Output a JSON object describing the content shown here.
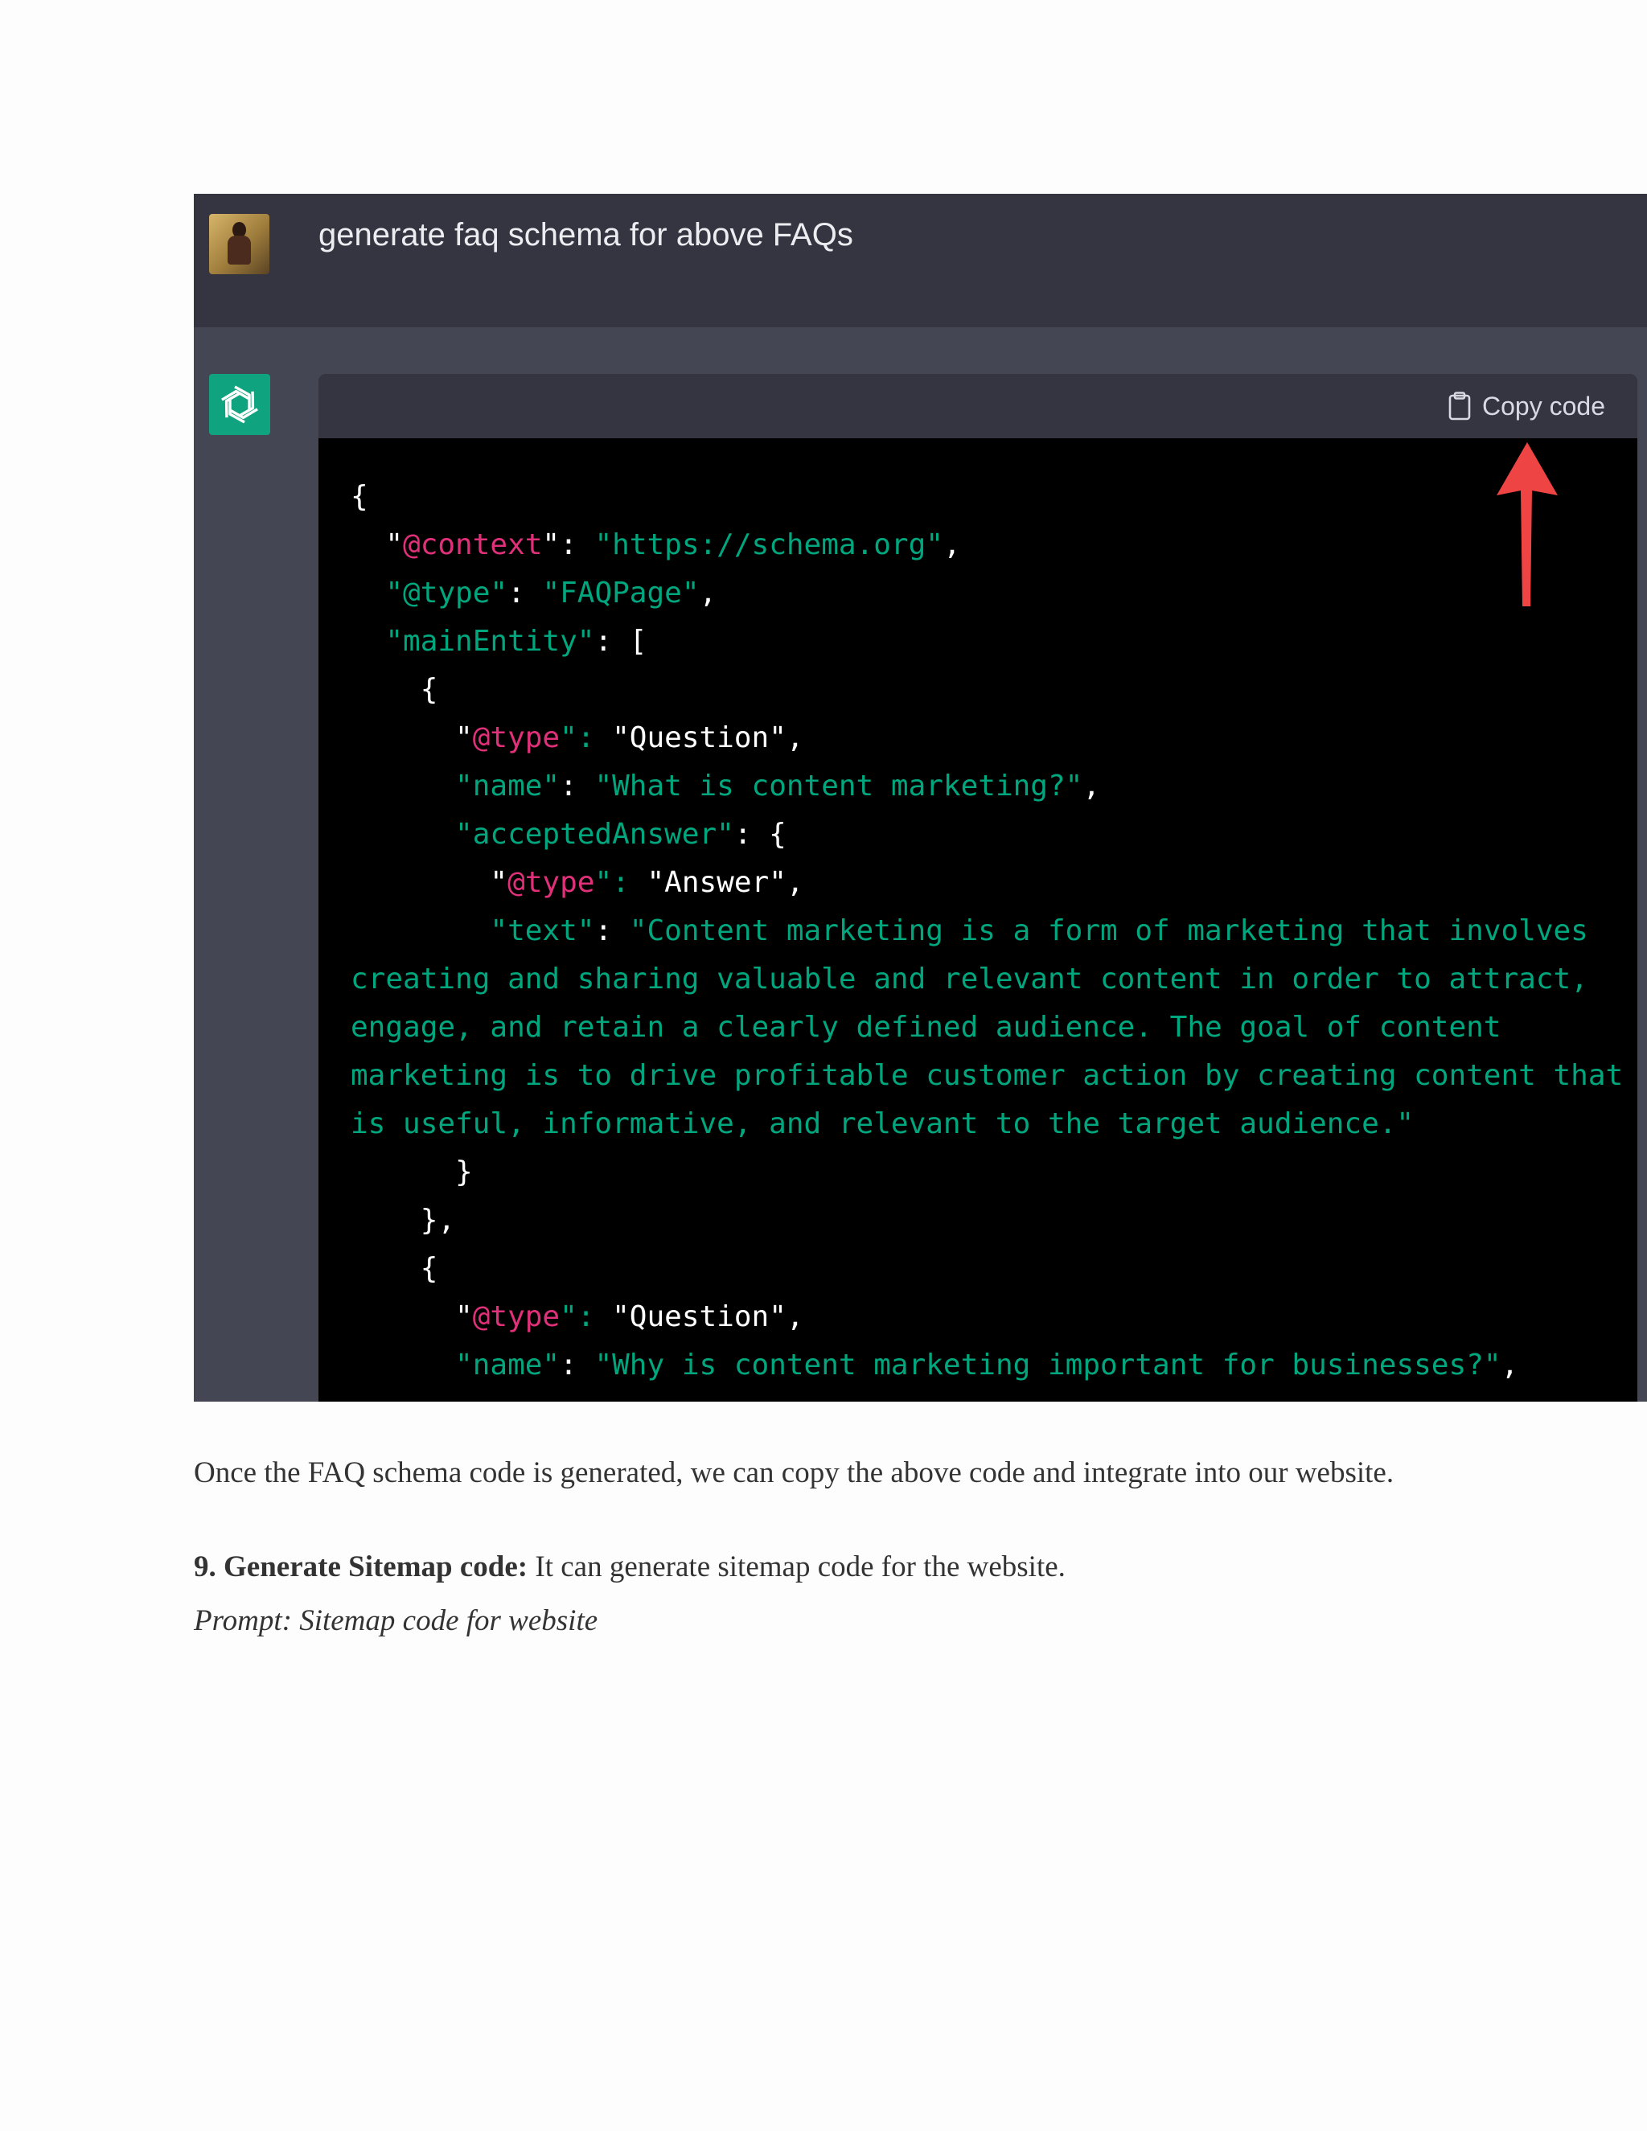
{
  "chat": {
    "user_prompt": "generate faq schema for above FAQs",
    "copy_label": "Copy code",
    "code_lines": [
      [
        {
          "t": "{",
          "c": "p"
        }
      ],
      [
        {
          "t": "  \"",
          "c": "p"
        },
        {
          "t": "@context",
          "c": "k"
        },
        {
          "t": "\": ",
          "c": "p"
        },
        {
          "t": "\"https://schema.org\"",
          "c": "s"
        },
        {
          "t": ",",
          "c": "p"
        }
      ],
      [
        {
          "t": "  \"@type\"",
          "c": "s"
        },
        {
          "t": ": ",
          "c": "p"
        },
        {
          "t": "\"FAQPage\"",
          "c": "s"
        },
        {
          "t": ",",
          "c": "p"
        }
      ],
      [
        {
          "t": "  \"mainEntity\"",
          "c": "s"
        },
        {
          "t": ": [",
          "c": "p"
        }
      ],
      [
        {
          "t": "    {",
          "c": "p"
        }
      ],
      [
        {
          "t": "      \"",
          "c": "p"
        },
        {
          "t": "@type",
          "c": "k"
        },
        {
          "t": "\": ",
          "c": "s"
        },
        {
          "t": "\"Question\",",
          "c": "p"
        }
      ],
      [
        {
          "t": "      \"name\"",
          "c": "s"
        },
        {
          "t": ": ",
          "c": "p"
        },
        {
          "t": "\"What is content marketing?\"",
          "c": "s"
        },
        {
          "t": ",",
          "c": "p"
        }
      ],
      [
        {
          "t": "      \"acceptedAnswer\"",
          "c": "s"
        },
        {
          "t": ": {",
          "c": "p"
        }
      ],
      [
        {
          "t": "        \"",
          "c": "p"
        },
        {
          "t": "@type",
          "c": "k"
        },
        {
          "t": "\": ",
          "c": "s"
        },
        {
          "t": "\"Answer\",",
          "c": "p"
        }
      ],
      [
        {
          "t": "        \"text\"",
          "c": "s"
        },
        {
          "t": ": ",
          "c": "p"
        },
        {
          "t": "\"Content marketing is a form of marketing that involves",
          "c": "s"
        }
      ],
      [
        {
          "t": "creating and sharing valuable and relevant content in order to attract,",
          "c": "s"
        }
      ],
      [
        {
          "t": "engage, and retain a clearly defined audience. The goal of content",
          "c": "s"
        }
      ],
      [
        {
          "t": "marketing is to drive profitable customer action by creating content that",
          "c": "s"
        }
      ],
      [
        {
          "t": "is useful, informative, and relevant to the target audience.\"",
          "c": "s"
        }
      ],
      [
        {
          "t": "      }",
          "c": "p"
        }
      ],
      [
        {
          "t": "    },",
          "c": "p"
        }
      ],
      [
        {
          "t": "    {",
          "c": "p"
        }
      ],
      [
        {
          "t": "      \"",
          "c": "p"
        },
        {
          "t": "@type",
          "c": "k"
        },
        {
          "t": "\": ",
          "c": "s"
        },
        {
          "t": "\"Question\",",
          "c": "p"
        }
      ],
      [
        {
          "t": "      \"name\"",
          "c": "s"
        },
        {
          "t": ": ",
          "c": "p"
        },
        {
          "t": "\"Why is content marketing important for businesses?\"",
          "c": "s"
        },
        {
          "t": ",",
          "c": "p"
        }
      ]
    ]
  },
  "article": {
    "paragraph1": "Once the FAQ schema code is generated, we can copy the above code and integrate into our website.",
    "heading9_bold": "9. Generate Sitemap code:",
    "heading9_text": " It can generate sitemap code for the website.",
    "prompt_line": "Prompt: Sitemap code for website"
  },
  "colors": {
    "code_key": "#df3079",
    "code_string": "#00a67d",
    "arrow": "#ef4444",
    "chatgpt_green": "#10a37f"
  }
}
